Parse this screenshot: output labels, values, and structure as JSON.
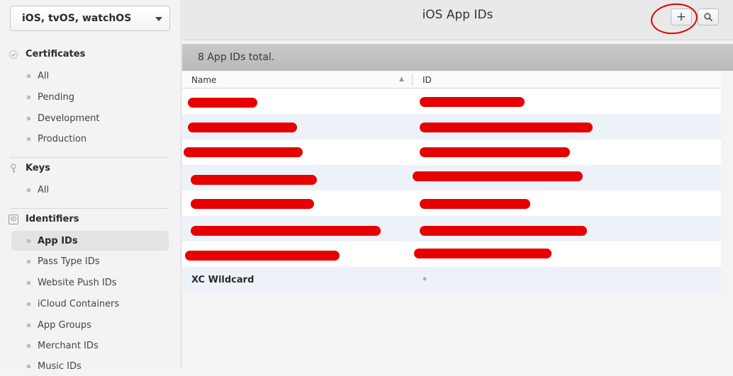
{
  "sidebar": {
    "platform_select": "iOS, tvOS, watchOS",
    "sections": {
      "certificates": {
        "title": "Certificates",
        "items": [
          "All",
          "Pending",
          "Development",
          "Production"
        ]
      },
      "keys": {
        "title": "Keys",
        "items": [
          "All"
        ]
      },
      "identifiers": {
        "title": "Identifiers",
        "icon_text": "ID",
        "items": [
          "App IDs",
          "Pass Type IDs",
          "Website Push IDs",
          "iCloud Containers",
          "App Groups",
          "Merchant IDs",
          "Music IDs"
        ],
        "active_item": "App IDs"
      }
    }
  },
  "header": {
    "title": "iOS App IDs",
    "add_icon": "+",
    "search_icon": "magnifier"
  },
  "summary": "8  App IDs total.",
  "table": {
    "columns": [
      "Name",
      "ID"
    ],
    "sort_indicator": "▲",
    "rows": [
      {
        "name": "",
        "id": "",
        "redacted": true
      },
      {
        "name": "",
        "id": "",
        "redacted": true
      },
      {
        "name": "",
        "id": "",
        "redacted": true
      },
      {
        "name": "",
        "id": "",
        "redacted": true
      },
      {
        "name": "",
        "id": "",
        "redacted": true
      },
      {
        "name": "",
        "id": "",
        "redacted": true
      },
      {
        "name": "",
        "id": "",
        "redacted": true
      },
      {
        "name": "XC Wildcard",
        "id": "*",
        "redacted": false
      }
    ]
  },
  "colors": {
    "redaction": "#e60000",
    "annotation": "#e00000",
    "active_nav": "#e3e3e3"
  }
}
